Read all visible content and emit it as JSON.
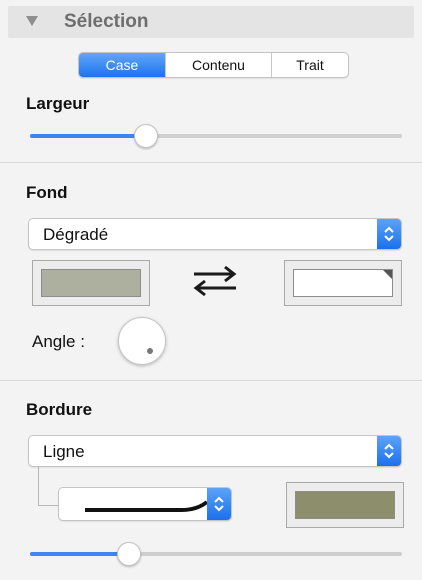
{
  "header": {
    "title": "Sélection"
  },
  "tabs": [
    {
      "label": "Case",
      "active": true
    },
    {
      "label": "Contenu",
      "active": false
    },
    {
      "label": "Trait",
      "active": false
    }
  ],
  "largeur": {
    "label": "Largeur",
    "value": 0.3
  },
  "fond": {
    "label": "Fond",
    "fill_type": "Dégradé",
    "start_color": "#adb09e",
    "end_color": "#ffffff",
    "swap_icon": "swap-arrows-icon",
    "angle_label": "Angle :"
  },
  "bordure": {
    "label": "Bordure",
    "line_type": "Ligne",
    "line_style_icon": "line-style-preview-icon",
    "color": "#8c8e6c",
    "width_value": 0.25
  },
  "colors": {
    "accent": "#3d86f2"
  }
}
